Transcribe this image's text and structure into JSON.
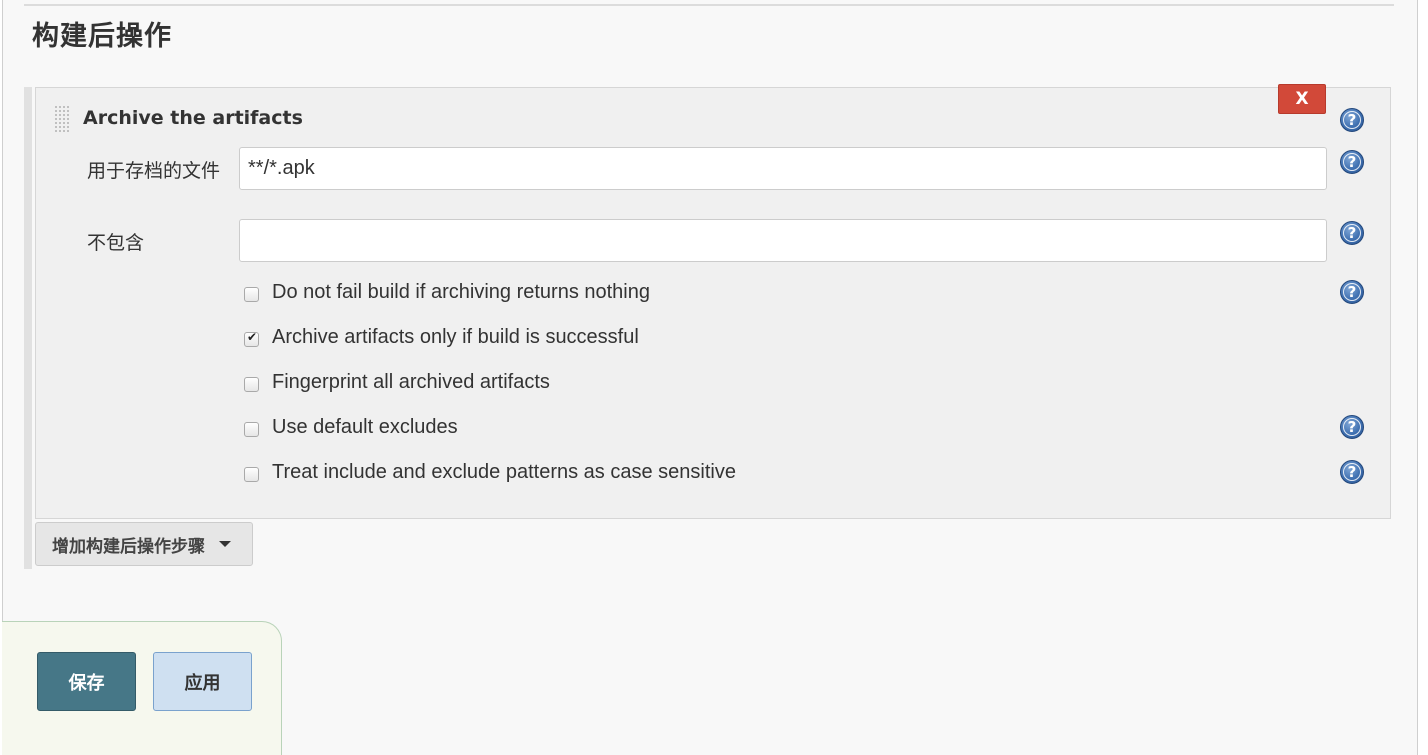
{
  "section": {
    "title": "构建后操作"
  },
  "publisher": {
    "title": "Archive the artifacts",
    "delete_label": "X",
    "help_glyph": "?",
    "fields": [
      {
        "label": "用于存档的文件",
        "value": "**/*.apk",
        "placeholder": ""
      },
      {
        "label": "不包含",
        "value": "",
        "placeholder": ""
      }
    ],
    "options": [
      {
        "label": "Do not fail build if archiving returns nothing",
        "checked": false,
        "has_help": true
      },
      {
        "label": "Archive artifacts only if build is successful",
        "checked": true,
        "has_help": false
      },
      {
        "label": "Fingerprint all archived artifacts",
        "checked": false,
        "has_help": false
      },
      {
        "label": "Use default excludes",
        "checked": false,
        "has_help": true
      },
      {
        "label": "Treat include and exclude patterns as case sensitive",
        "checked": false,
        "has_help": true
      }
    ]
  },
  "add_step": {
    "label": "增加构建后操作步骤"
  },
  "footer": {
    "save_label": "保存",
    "apply_label": "应用"
  },
  "colors": {
    "delete": "#d24939",
    "save": "#467787",
    "apply": "#cfe0f1",
    "help_icon": "#3e6fb0"
  },
  "icons": {
    "help": "help-icon",
    "drag": "drag-handle-icon",
    "caret": "caret-down-icon",
    "check": "checkmark-icon"
  }
}
